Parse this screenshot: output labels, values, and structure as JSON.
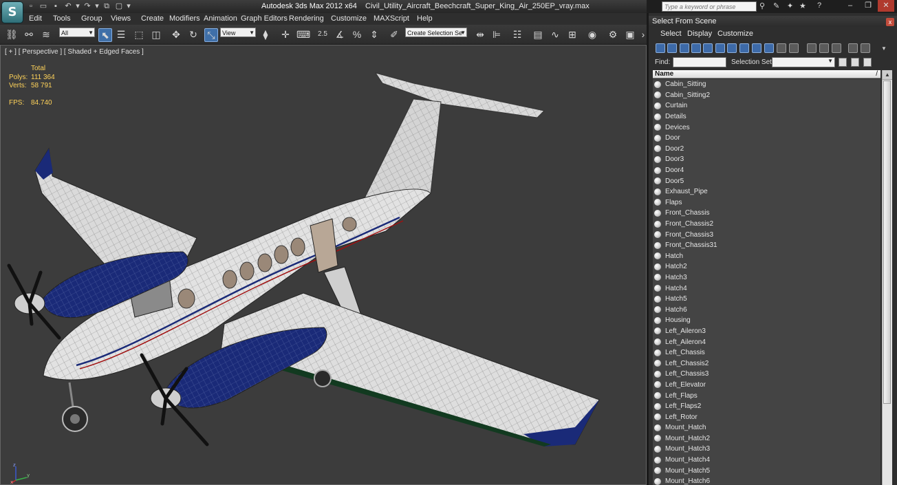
{
  "app": {
    "logo_glyph": "S",
    "title_prefix": "Autodesk 3ds Max  2012 x64",
    "file_name": "Civil_Utility_Aircraft_Beechcraft_Super_King_Air_250EP_vray.max",
    "search_placeholder": "Type a keyword or phrase"
  },
  "menu": [
    "Edit",
    "Tools",
    "Group",
    "Views",
    "Create",
    "Modifiers",
    "Animation",
    "Graph Editors",
    "Rendering",
    "Customize",
    "MAXScript",
    "Help"
  ],
  "toolbar": {
    "filter_value": "All",
    "ref_coord_value": "View",
    "snap_label": "2.5",
    "selection_set_placeholder": "Create Selection Se"
  },
  "viewport": {
    "label": "[ + ] [ Perspective ] [ Shaded + Edged Faces ]",
    "stats": {
      "header": "Total",
      "polys_label": "Polys:",
      "polys_value": "111 364",
      "verts_label": "Verts:",
      "verts_value": "58 791",
      "fps_label": "FPS:",
      "fps_value": "84.740"
    },
    "axis_labels": {
      "x": "x",
      "y": "y",
      "z": "z"
    }
  },
  "panel": {
    "title": "Select From Scene",
    "close_glyph": "x",
    "menu": [
      "Select",
      "Display",
      "Customize"
    ],
    "find_label": "Find:",
    "find_value": "",
    "selection_set_label": "Selection Set:",
    "column_header": "Name",
    "objects": [
      "Cabin_Sitting",
      "Cabin_Sitting2",
      "Curtain",
      "Details",
      "Devices",
      "Door",
      "Door2",
      "Door3",
      "Door4",
      "Door5",
      "Exhaust_Pipe",
      "Flaps",
      "Front_Chassis",
      "Front_Chassis2",
      "Front_Chassis3",
      "Front_Chassis31",
      "Hatch",
      "Hatch2",
      "Hatch3",
      "Hatch4",
      "Hatch5",
      "Hatch6",
      "Housing",
      "Left_Aileron3",
      "Left_Aileron4",
      "Left_Chassis",
      "Left_Chassis2",
      "Left_Chassis3",
      "Left_Elevator",
      "Left_Flaps",
      "Left_Flaps2",
      "Left_Rotor",
      "Mount_Hatch",
      "Mount_Hatch2",
      "Mount_Hatch3",
      "Mount_Hatch4",
      "Mount_Hatch5",
      "Mount_Hatch6"
    ]
  },
  "colors": {
    "viewport_bg": "#3c3c3c",
    "stats_text": "#ffd35a",
    "panel_bg": "#2e2e2e",
    "engine_blue": "#1a2a78",
    "accent_selected": "#3f6fa8"
  }
}
